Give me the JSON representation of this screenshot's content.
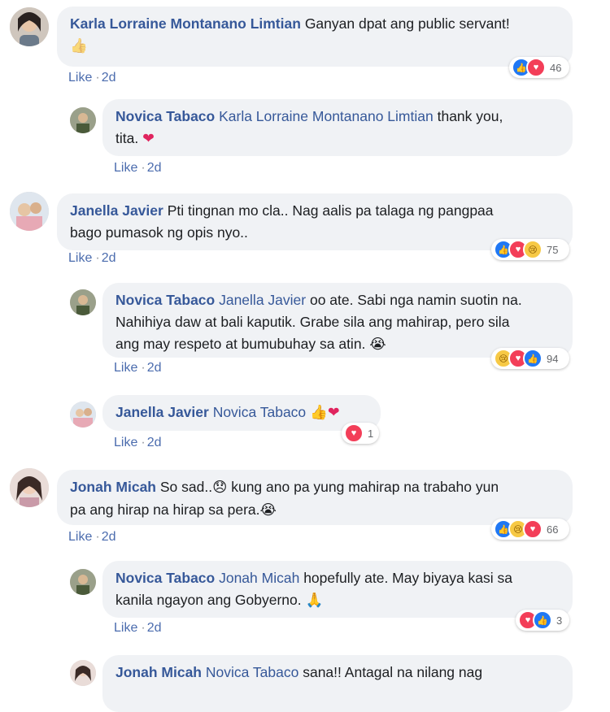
{
  "comments": [
    {
      "name": "Karla Lorraine Montanano Limtian",
      "text_line1": "Ganyan dpat ang public servant!",
      "emoji": "👍",
      "like": "Like",
      "time": "2d",
      "reaction_count": "46",
      "reactions": [
        "like",
        "love"
      ]
    },
    {
      "name": "Novica Tabaco",
      "tag": "Karla Lorraine Montanano Limtian",
      "text_line1": "thank you,",
      "text_line2": "tita.",
      "emoji": "❤",
      "like": "Like",
      "time": "2d"
    },
    {
      "name": "Janella Javier",
      "text_line1": "Pti tingnan mo cla.. Nag aalis pa talaga ng pangpaa",
      "text_line2": "bago pumasok ng opis nyo..",
      "like": "Like",
      "time": "2d",
      "reaction_count": "75",
      "reactions": [
        "like",
        "love",
        "sad"
      ]
    },
    {
      "name": "Novica Tabaco",
      "tag": "Janella Javier",
      "text_line1": "oo ate. Sabi nga namin suotin na.",
      "text_line2": "Nahihiya daw at bali kaputik. Grabe sila ang mahirap, pero sila",
      "text_line3": "ang may respeto at bumubuhay sa atin.",
      "emoji": "😭",
      "like": "Like",
      "time": "2d",
      "reaction_count": "94",
      "reactions": [
        "sad",
        "love",
        "like"
      ]
    },
    {
      "name": "Janella Javier",
      "tag": "Novica Tabaco",
      "emoji": "👍❤",
      "like": "Like",
      "time": "2d",
      "reaction_count": "1",
      "reactions": [
        "love"
      ]
    },
    {
      "name": "Jonah Micah",
      "text_line1": "So sad..",
      "emoji1": "😞",
      "text_line1b": "kung ano pa yung mahirap na trabaho yun",
      "text_line2": "pa ang hirap na hirap sa pera.",
      "emoji2": "😭",
      "like": "Like",
      "time": "2d",
      "reaction_count": "66",
      "reactions": [
        "like",
        "sad",
        "love"
      ]
    },
    {
      "name": "Novica Tabaco",
      "tag": "Jonah Micah",
      "text_line1": "hopefully ate. May biyaya kasi sa",
      "text_line2": "kanila ngayon ang Gobyerno.",
      "emoji": "🙏",
      "like": "Like",
      "time": "2d",
      "reaction_count": "3",
      "reactions": [
        "love",
        "like"
      ]
    },
    {
      "name": "Jonah Micah",
      "tag": "Novica Tabaco",
      "text_line1": "sana!! Antagal na nilang nag"
    }
  ],
  "icons": {
    "like": "👍",
    "love": "♥",
    "sad": "😢"
  },
  "colors": {
    "name": "#365899",
    "bubble": "#f0f2f5",
    "like_blue": "#2078f4",
    "love_red": "#f33e58",
    "sad_yellow": "#f7c945"
  }
}
